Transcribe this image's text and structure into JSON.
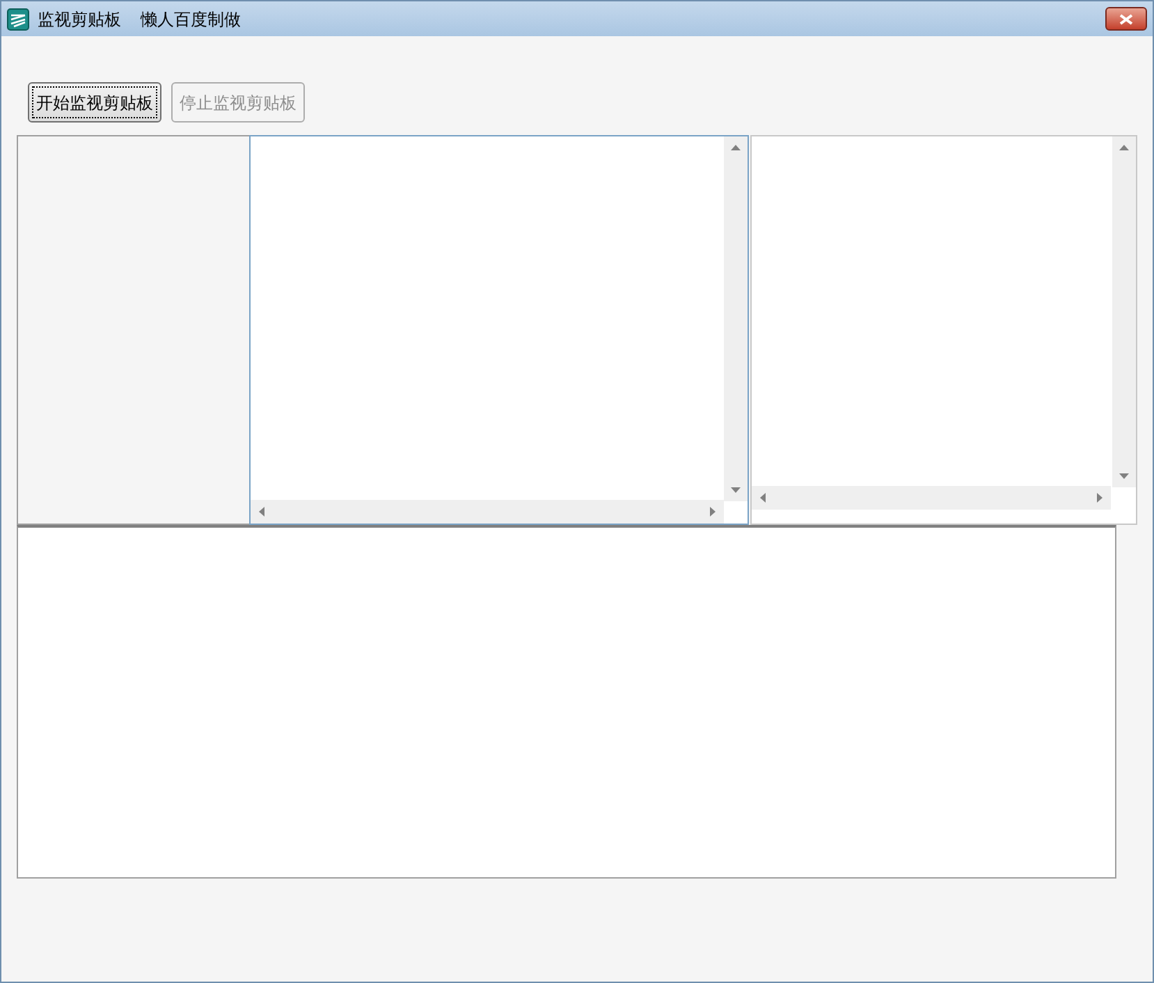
{
  "window": {
    "title": "监视剪贴板",
    "subtitle": "懒人百度制做"
  },
  "buttons": [
    {
      "label": "开始监视剪贴板",
      "disabled": false,
      "focused": true
    },
    {
      "label": "停止监视剪贴板",
      "disabled": true,
      "focused": false
    }
  ]
}
